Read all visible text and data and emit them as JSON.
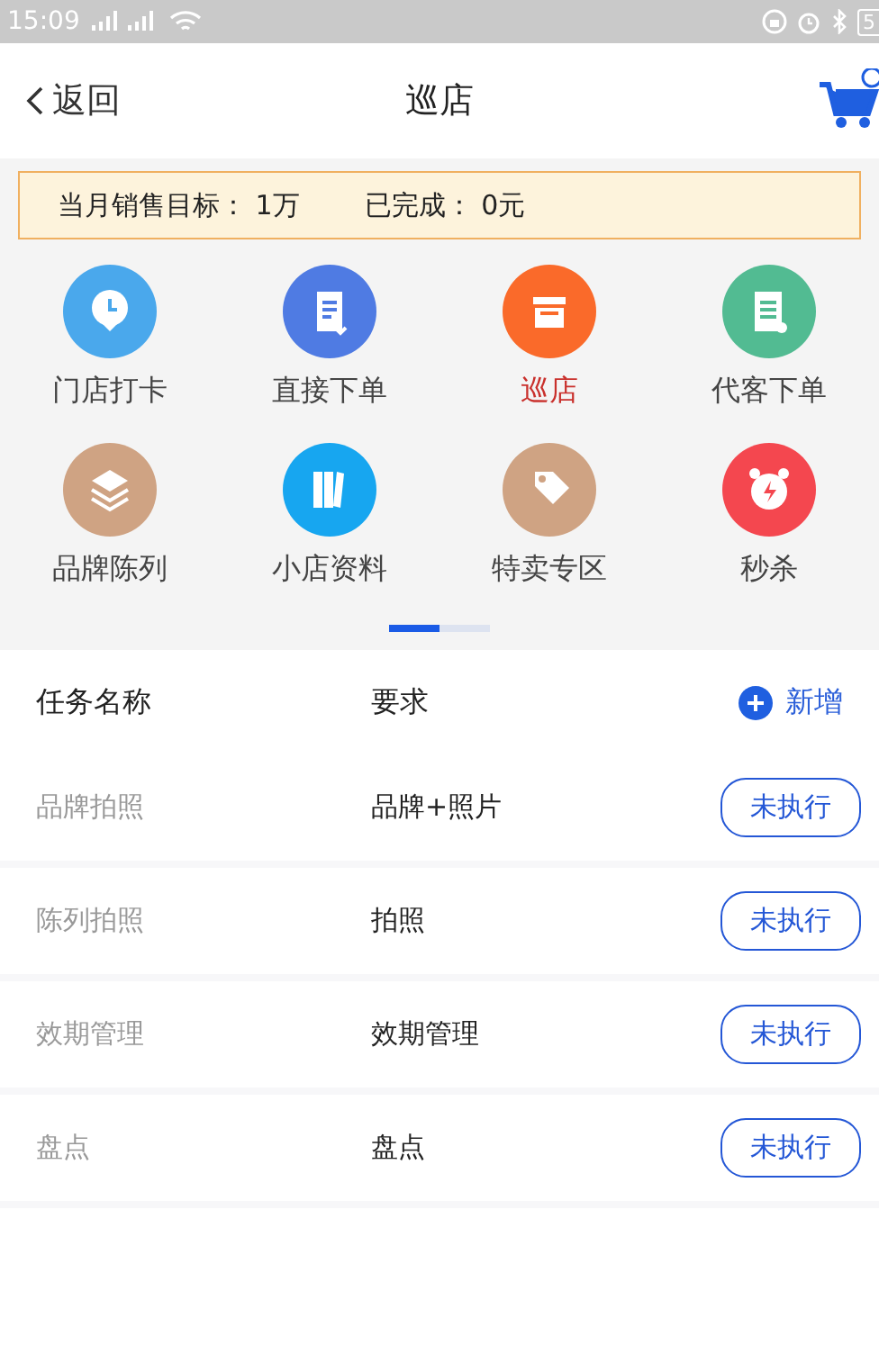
{
  "status_bar": {
    "time": "15:09",
    "battery": "5"
  },
  "header": {
    "back": "返回",
    "title": "巡店"
  },
  "banner": {
    "target_label": "当月销售目标：",
    "target_value": "1万",
    "done_label": "已完成：",
    "done_value": "0元"
  },
  "menu": [
    {
      "label": "门店打卡",
      "kind": "clock",
      "color": "#4aa8ec",
      "selected": false
    },
    {
      "label": "直接下单",
      "kind": "doc",
      "color": "#4f7be3",
      "selected": false
    },
    {
      "label": "巡店",
      "kind": "store",
      "color": "#fa6a2a",
      "selected": true
    },
    {
      "label": "代客下单",
      "kind": "list",
      "color": "#52bb92",
      "selected": false
    },
    {
      "label": "品牌陈列",
      "kind": "layers",
      "color": "#cfa383",
      "selected": false
    },
    {
      "label": "小店资料",
      "kind": "books",
      "color": "#17a6f0",
      "selected": false
    },
    {
      "label": "特卖专区",
      "kind": "tag",
      "color": "#cfa383",
      "selected": false
    },
    {
      "label": "秒杀",
      "kind": "alarm",
      "color": "#f4474f",
      "selected": false
    }
  ],
  "pager": [
    {
      "selected": true
    },
    {
      "selected": false
    }
  ],
  "table": {
    "columns": [
      "任务名称",
      "要求"
    ],
    "add": "新增",
    "rows": [
      {
        "name": "品牌拍照",
        "requirement": "品牌+照片",
        "status": "未执行"
      },
      {
        "name": "陈列拍照",
        "requirement": "拍照",
        "status": "未执行"
      },
      {
        "name": "效期管理",
        "requirement": "效期管理",
        "status": "未执行"
      },
      {
        "name": "盘点",
        "requirement": "盘点",
        "status": "未执行"
      }
    ]
  }
}
